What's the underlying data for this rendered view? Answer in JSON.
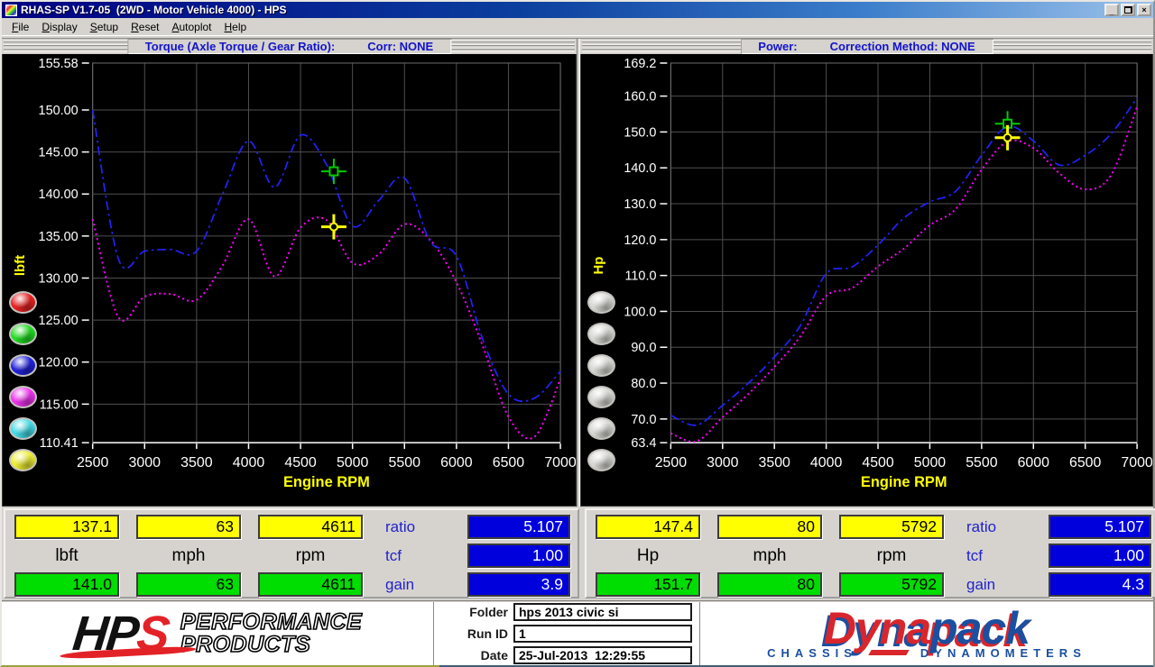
{
  "window": {
    "title": "RHAS-SP V1.7-05  (2WD - Motor Vehicle 4000) - HPS",
    "controls": {
      "minimize": "_",
      "close": "×"
    }
  },
  "menu": {
    "items": [
      "File",
      "Display",
      "Setup",
      "Reset",
      "Autoplot",
      "Help"
    ]
  },
  "chart_data": [
    {
      "type": "line",
      "name": "torque",
      "header": {
        "title": "Torque (Axle Torque / Gear Ratio):",
        "correction": "Corr: NONE"
      },
      "y_label": "lbft",
      "x_label": "Engine RPM",
      "y_min": 110.41,
      "y_max": 155.58,
      "y_ticks": [
        "155.58",
        "150.00",
        "145.00",
        "140.00",
        "135.00",
        "130.00",
        "125.00",
        "120.00",
        "115.00",
        "110.41"
      ],
      "x_min": 2500,
      "x_max": 7000,
      "x_ticks": [
        "2500",
        "3000",
        "3500",
        "4000",
        "4500",
        "5000",
        "5500",
        "6000",
        "6500",
        "7000"
      ],
      "grid": true,
      "rpm": [
        2500,
        2750,
        3000,
        3250,
        3500,
        3750,
        4000,
        4250,
        4500,
        4750,
        5000,
        5250,
        5500,
        5750,
        6000,
        6250,
        6500,
        6750,
        7000
      ],
      "series": [
        {
          "name": "run-1-dotted",
          "color": "#ff00ff",
          "style": "dotted",
          "values": [
            137.0,
            125.3,
            127.8,
            128.1,
            127.4,
            131.5,
            137.0,
            130.2,
            136.0,
            136.9,
            131.8,
            132.8,
            136.4,
            134.5,
            129.5,
            122.0,
            113.5,
            111.1,
            118.0
          ]
        },
        {
          "name": "run-2-dashdot",
          "color": "#2222ff",
          "style": "dashdot",
          "values": [
            150.0,
            132.2,
            133.2,
            133.4,
            133.2,
            140.0,
            146.3,
            140.8,
            147.0,
            143.5,
            136.2,
            139.2,
            141.9,
            134.3,
            132.6,
            122.8,
            116.2,
            115.7,
            118.9
          ]
        }
      ],
      "markers": [
        {
          "color": "#00cc00",
          "shape": "square",
          "rpm": 4820,
          "value": 142.7
        },
        {
          "color": "#ffff00",
          "shape": "circle",
          "rpm": 4820,
          "value": 136.1
        }
      ],
      "side_buttons": [
        "#e82222",
        "#22dd22",
        "#2222dd",
        "#ee33ee",
        "#44dde8",
        "#eeee33"
      ]
    },
    {
      "type": "line",
      "name": "power",
      "header": {
        "title": "Power:",
        "correction": "Correction Method: NONE"
      },
      "y_label": "Hp",
      "x_label": "Engine RPM",
      "y_min": 63.4,
      "y_max": 169.2,
      "y_ticks": [
        "169.2",
        "160.0",
        "150.0",
        "140.0",
        "130.0",
        "120.0",
        "110.0",
        "100.0",
        "90.0",
        "80.0",
        "70.0",
        "63.4"
      ],
      "x_min": 2500,
      "x_max": 7000,
      "x_ticks": [
        "2500",
        "3000",
        "3500",
        "4000",
        "4500",
        "5000",
        "5500",
        "6000",
        "6500",
        "7000"
      ],
      "grid": true,
      "rpm": [
        2500,
        2750,
        3000,
        3250,
        3500,
        3750,
        4000,
        4250,
        4500,
        4750,
        5000,
        5250,
        5500,
        5750,
        6000,
        6250,
        6500,
        6750,
        7000
      ],
      "series": [
        {
          "name": "run-1-dotted",
          "color": "#ff00ff",
          "style": "dotted",
          "values": [
            66.0,
            63.8,
            70.5,
            77.0,
            84.5,
            93.0,
            104.3,
            106.5,
            112.5,
            117.5,
            124.0,
            128.5,
            139.5,
            147.3,
            145.5,
            138.5,
            134.0,
            138.0,
            157.0
          ]
        },
        {
          "name": "run-2-dashdot",
          "color": "#2222ff",
          "style": "dashdot",
          "values": [
            71.0,
            68.3,
            73.8,
            80.0,
            87.3,
            96.0,
            110.5,
            112.4,
            118.5,
            126.0,
            130.5,
            133.5,
            143.5,
            151.5,
            147.5,
            140.8,
            143.5,
            149.5,
            159.5
          ]
        }
      ],
      "markers": [
        {
          "color": "#00cc00",
          "shape": "square",
          "rpm": 5750,
          "value": 152.3
        },
        {
          "color": "#ffff00",
          "shape": "circle",
          "rpm": 5750,
          "value": 148.4
        }
      ],
      "side_buttons": [
        "#d8d8d4",
        "#d8d8d4",
        "#d8d8d4",
        "#d8d8d4",
        "#d8d8d4",
        "#d8d8d4"
      ]
    }
  ],
  "readouts": [
    {
      "top_values": [
        "137.1",
        "63",
        "4611"
      ],
      "units": [
        "lbft",
        "mph",
        "rpm"
      ],
      "bottom_values": [
        "141.0",
        "63",
        "4611"
      ],
      "params": [
        {
          "label": "ratio",
          "value": "5.107"
        },
        {
          "label": "tcf",
          "value": "1.00"
        },
        {
          "label": "gain",
          "value": "3.9"
        }
      ],
      "top_color": "#ffff00",
      "bottom_color": "#00dd00",
      "param_box_color": "#0000dd"
    },
    {
      "top_values": [
        "147.4",
        "80",
        "5792"
      ],
      "units": [
        "Hp",
        "mph",
        "rpm"
      ],
      "bottom_values": [
        "151.7",
        "80",
        "5792"
      ],
      "params": [
        {
          "label": "ratio",
          "value": "5.107"
        },
        {
          "label": "tcf",
          "value": "1.00"
        },
        {
          "label": "gain",
          "value": "4.3"
        }
      ],
      "top_color": "#ffff00",
      "bottom_color": "#00dd00",
      "param_box_color": "#0000dd"
    }
  ],
  "footer": {
    "hps": {
      "hp": "HP",
      "s": "S",
      "line1": "PERFORMANCE",
      "line2": "PRODUCTS"
    },
    "fields": [
      {
        "label": "Folder",
        "value": "hps 2013 civic si"
      },
      {
        "label": "Run ID",
        "value": "1"
      },
      {
        "label": "Date",
        "value": "25-Jul-2013  12:29:55"
      }
    ],
    "dynapack": {
      "word_red": "Dyna",
      "word_blue": "pack",
      "sub_left": "CHASSIS",
      "sub_right": "DYNAMOMETERS"
    }
  }
}
